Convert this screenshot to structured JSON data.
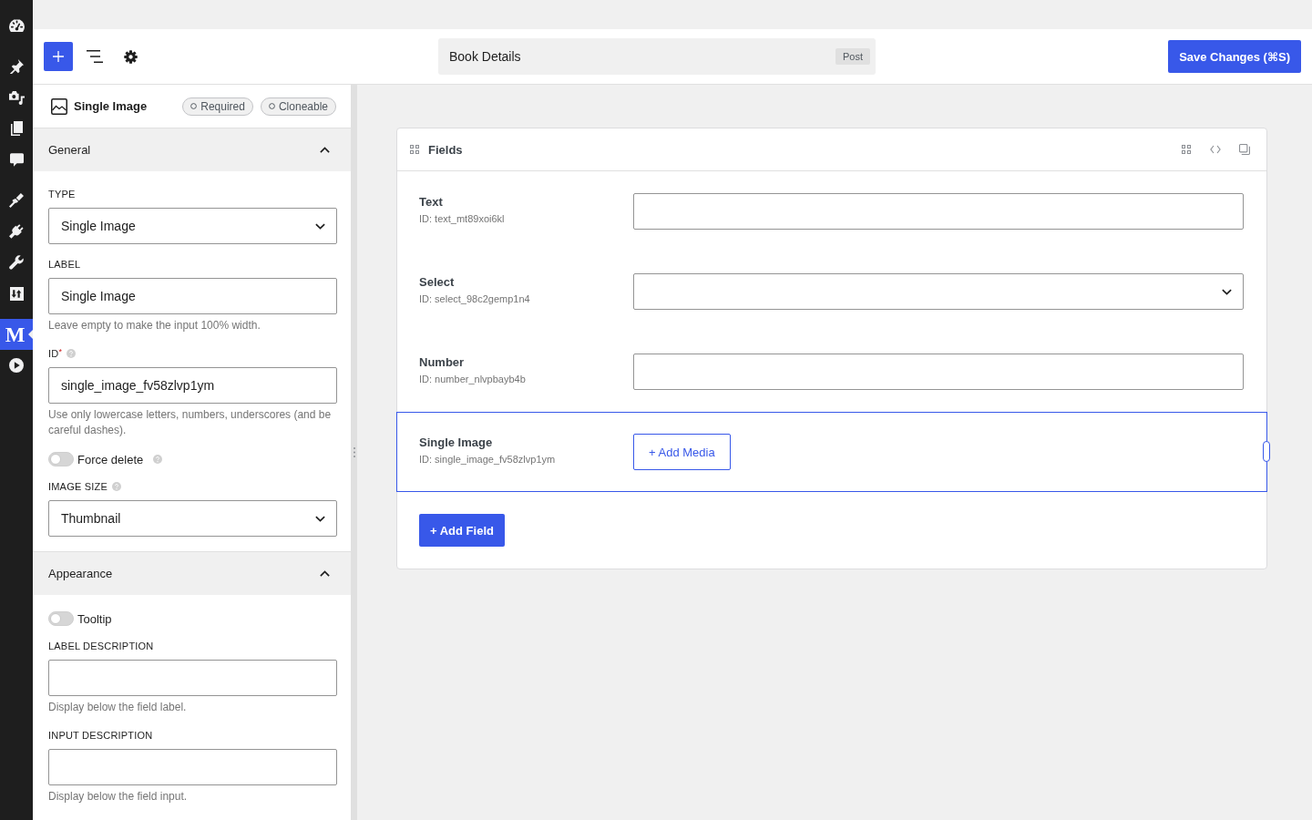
{
  "admin_menu": [
    {
      "selected": false
    },
    {
      "selected": false
    },
    {
      "selected": false
    },
    {
      "selected": false
    },
    {
      "selected": false
    },
    {
      "selected": false
    },
    {
      "selected": false
    },
    {
      "selected": false
    },
    {
      "selected": false
    },
    {
      "selected": true,
      "label": "M"
    },
    {
      "selected": false
    }
  ],
  "toolbar": {
    "title": "Book Details",
    "post_type": "Post",
    "save_button": "Save Changes (⌘S)"
  },
  "field_settings": {
    "type_label": "Single Image",
    "options": [
      {
        "label": "Required",
        "on": false
      },
      {
        "label": "Cloneable",
        "on": false
      }
    ],
    "sections": [
      {
        "title": "General",
        "expanded": true,
        "controls": [
          {
            "kind": "select",
            "label": "TYPE",
            "info": false,
            "value": "Single Image"
          },
          {
            "kind": "text",
            "label": "LABEL",
            "info": false,
            "value": "Single Image",
            "help": "Leave empty to make the input 100% width."
          },
          {
            "kind": "text",
            "label": "ID$^{*}$",
            "info": true,
            "value": "single_image_fv58zlvp1ym",
            "help": "Use only lowercase letters, numbers, underscores (and be careful dashes)."
          },
          {
            "kind": "toggle",
            "label": "Force delete",
            "info": true,
            "on": false
          },
          {
            "kind": "select",
            "label": "IMAGE SIZE",
            "info": true,
            "value": "Thumbnail"
          }
        ]
      },
      {
        "title": "Appearance",
        "expanded": true,
        "controls": [
          {
            "kind": "toggle",
            "label": "Tooltip",
            "info": false,
            "on": false
          },
          {
            "kind": "text",
            "label": "LABEL DESCRIPTION",
            "info": false,
            "help": "Display below the field label."
          },
          {
            "kind": "text",
            "label": "INPUT DESCRIPTION",
            "info": false,
            "help": "Display below the field input."
          }
        ]
      }
    ]
  },
  "fields_panel": {
    "title": "Fields",
    "rows": [
      {
        "kind": "text",
        "label": "Text",
        "id_text": "ID: text_mt89xoi6kl",
        "selected": false
      },
      {
        "kind": "select",
        "label": "Select",
        "id_text": "ID: select_98c2gemp1n4",
        "selected": false
      },
      {
        "kind": "number",
        "label": "Number",
        "id_text": "ID: number_nlvpbayb4b",
        "selected": false
      },
      {
        "kind": "image",
        "label": "Single Image",
        "id_text": "ID: single_image_fv58zlvp1ym",
        "button": "+ Add Media",
        "selected": true
      }
    ],
    "add_button": "+ Add Field"
  }
}
